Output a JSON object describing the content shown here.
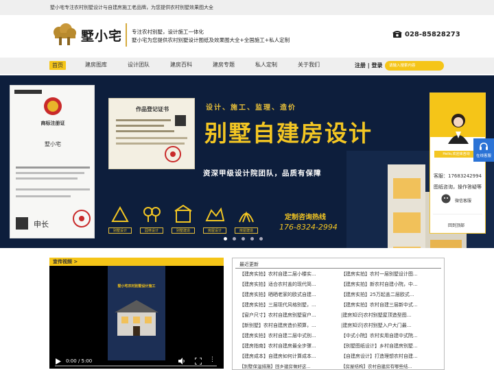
{
  "topbar": {
    "text": "墅小宅专注农村别墅设计与自建房施工老品牌，为您提供农村别墅效果图大全"
  },
  "header": {
    "brand": "墅小宅",
    "slogan_line1": "专注农村别墅，设计施工一体化",
    "slogan_line2": "墅小宅为您提供农村别墅设计图纸及效果图大全+全国施工+私人定制",
    "phone": "028-85828273"
  },
  "nav": {
    "items": [
      "首页",
      "建房图库",
      "设计团队",
      "建房百科",
      "建房专题",
      "私人定制",
      "关于我们"
    ],
    "login": "注册 | 登录",
    "search_placeholder": "请输入搜索内容"
  },
  "banner": {
    "tagline": "设计、施工、监理、造价",
    "headline": "别墅自建房设计",
    "subline": "资深甲级设计院团队，品质有保障",
    "hotline_label": "定制咨询热线",
    "hotline_number": "176-8324-2994",
    "cert1_title": "商标注册证",
    "cert1_name": "墅小宅",
    "cert2_title": "作品登记证书",
    "features": [
      "别墅设计",
      "园林设计",
      "别墅建造",
      "房屋设计",
      "房屋建造"
    ],
    "slide_count": 5,
    "active_slide": 1
  },
  "sidebar": {
    "online_label": "Hello,欢迎来咨询",
    "kefu": "客服：17683242994",
    "draw_consult": "图纸咨询，操作答疑等",
    "wechat": "微信客服",
    "back_top": "回到顶部"
  },
  "float_service": {
    "label": "在线客服"
  },
  "video_section": {
    "title": "宣传视频 >",
    "time": "0:00 / 5:00",
    "poster_title": "墅小宅农村别墅设计施工"
  },
  "news": {
    "title": "最近更新",
    "left": [
      "【建房实拍】农村自建二层小楼实...",
      "【建房实拍】适合农村盖的现代简...",
      "【建房实拍】晒晒老家的欧式自建...",
      "【建房实拍】三层现代风格别墅，...",
      "【窗户尺寸】农村自建房别墅窗户...",
      "【新别墅】农村自建房造价预算，...",
      "【建房实拍】农村自建二层中式别...",
      "【建房指南】农村自建房最全步骤...",
      "【建房成本】自建房如何计算成本...",
      "【别墅保温措施】回乡建房做好这..."
    ],
    "right": [
      "【建房实拍】农村一层别墅设计图...",
      "【建房实拍】新农村自建小院，中...",
      "【建房实拍】25万起盖二层欧式...",
      "【建房实拍】农村自建三层新中式...",
      "|建房知识|农村别墅屋顶造型图...",
      "|建房知识|农村别墅入户大门最...",
      "【中式小院】农村实用自建中式院...",
      "【别墅图纸设计】乡村自建房别墅...",
      "【自建房设计】打造理想农村自建...",
      "【房屋结构】农村自建房有哪些结..."
    ]
  },
  "colors": {
    "accent": "#f5c518",
    "banner_bg": "#0d1e3c",
    "brand_gold": "#d5a93c"
  }
}
